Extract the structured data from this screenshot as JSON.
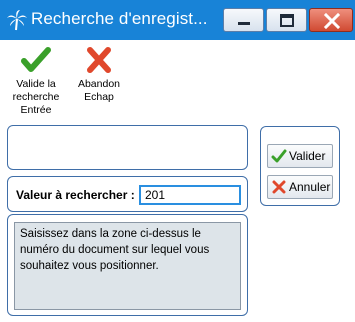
{
  "window": {
    "title": "Recherche d'enregist...",
    "controls": {
      "minimize_icon": "minimize-icon",
      "maximize_icon": "maximize-icon",
      "close_icon": "close-icon"
    }
  },
  "toolbar": {
    "validate": {
      "label_line1": "Valide la",
      "label_line2": "recherche",
      "label_line3": "Entrée",
      "icon": "check-icon"
    },
    "abandon": {
      "label_line1": "Abandon",
      "label_line2": "Echap",
      "icon": "cross-icon"
    }
  },
  "search": {
    "label": "Valeur à rechercher :",
    "value": "201"
  },
  "info": {
    "text": "Saisissez dans la zone ci-dessus le numéro du document sur lequel vous souhaitez vous positionner."
  },
  "actions": {
    "ok_label": "Valider",
    "cancel_label": "Annuler"
  },
  "colors": {
    "titlebar": "#1883d7",
    "panel_border": "#3f6ea8",
    "check_green": "#3aa02a",
    "cross_red": "#e0482c",
    "info_background": "#dde4e9"
  }
}
